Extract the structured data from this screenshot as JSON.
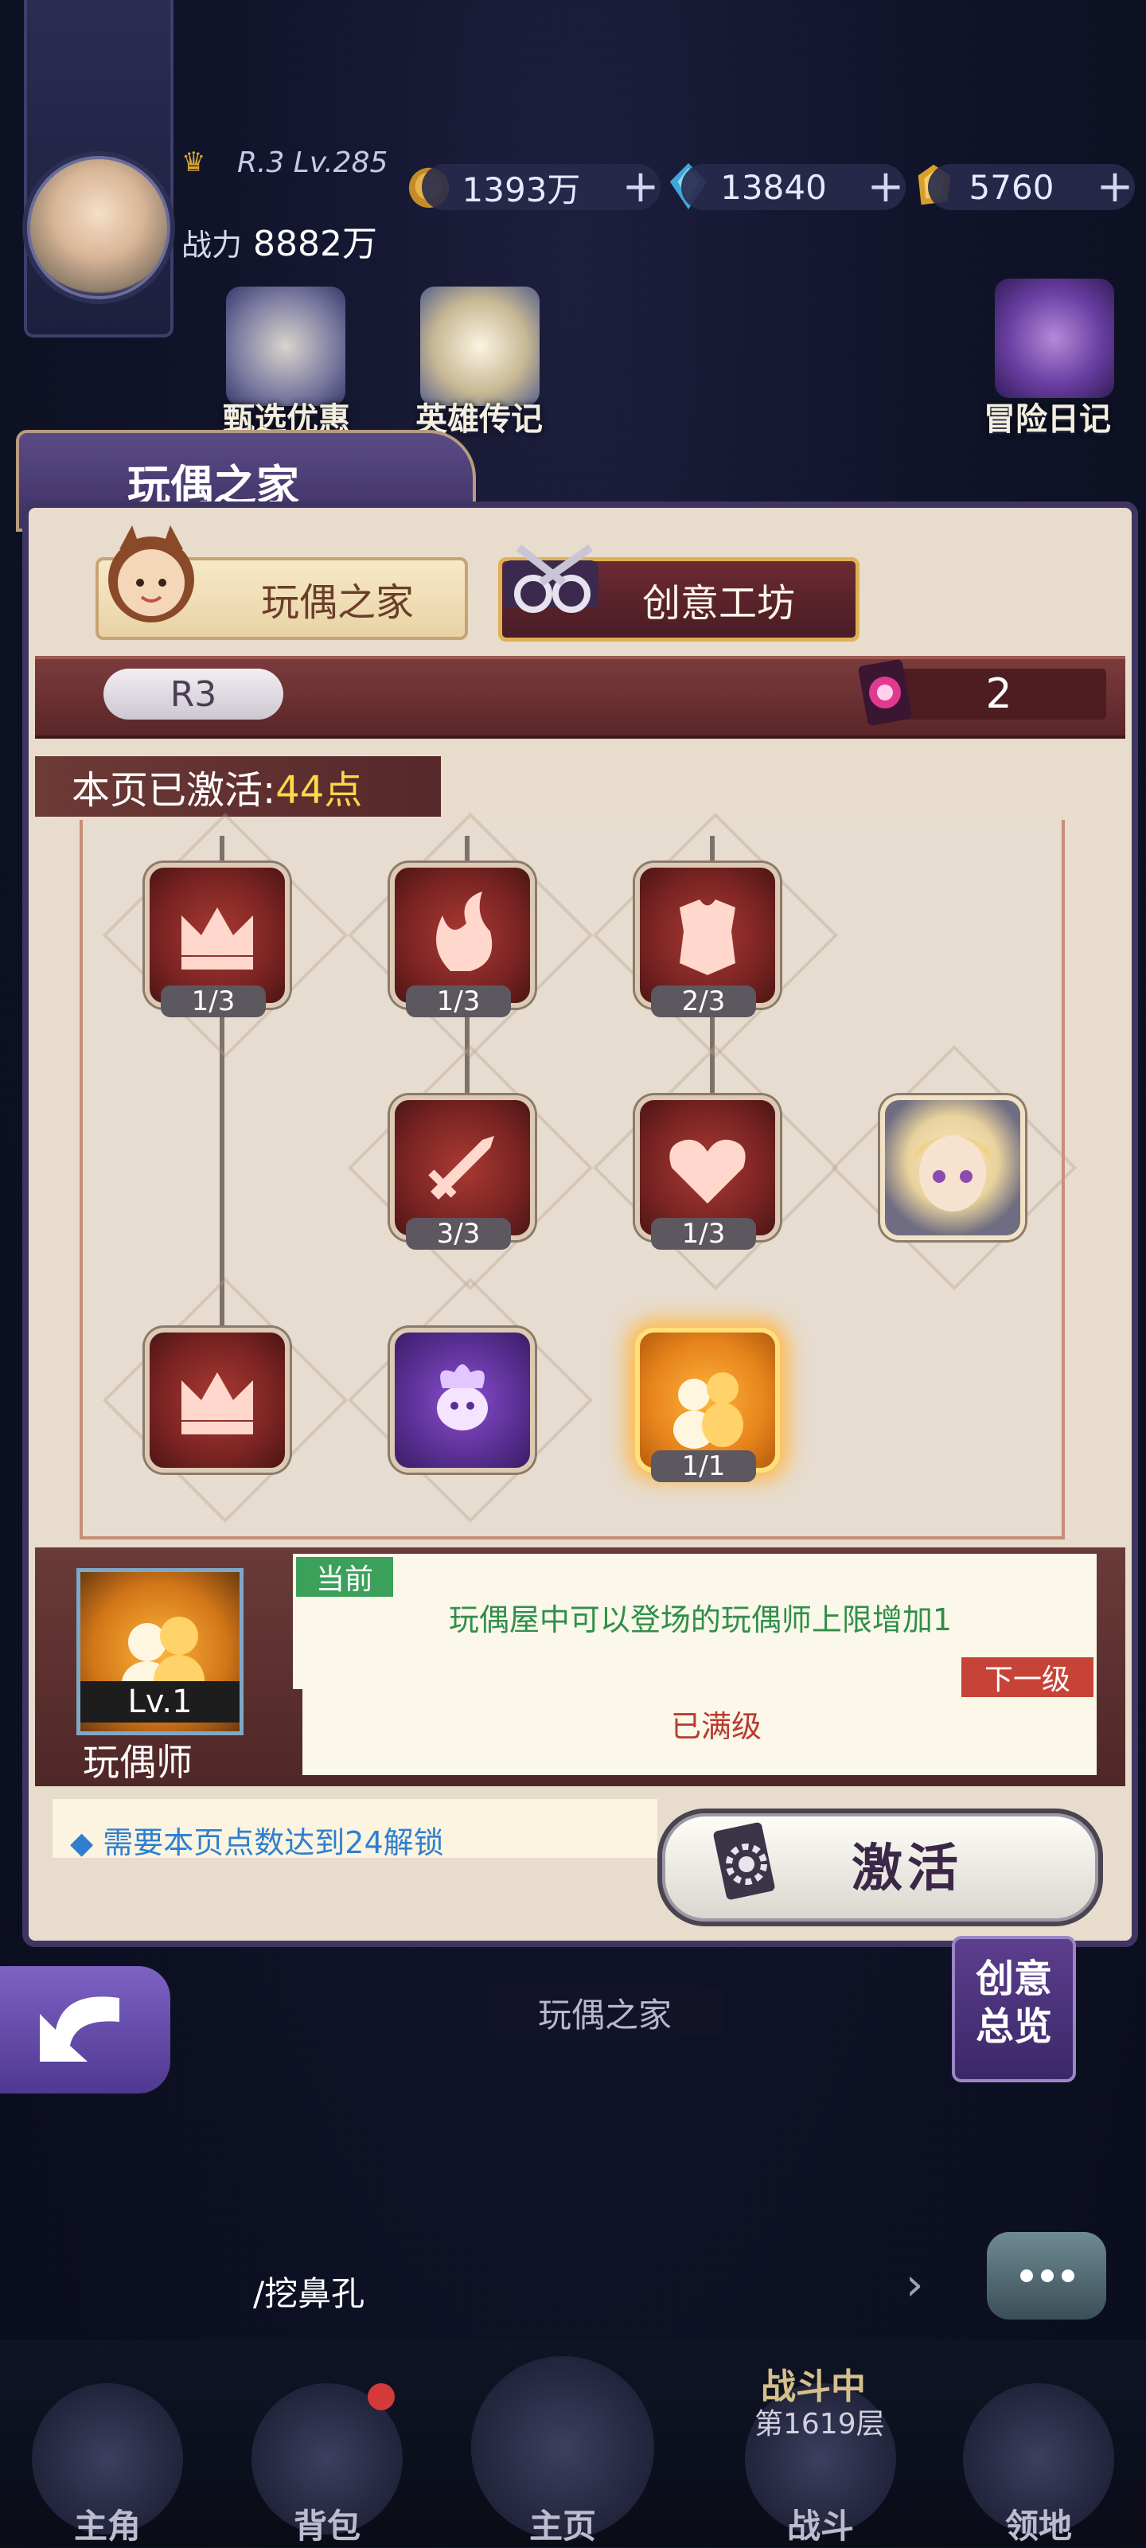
{
  "player": {
    "rank_level": "R.3 Lv.285",
    "power_label": "战力",
    "power_value": "8882万"
  },
  "resources": [
    {
      "icon": "gold-coin-icon",
      "value": "1393万"
    },
    {
      "icon": "blue-crystal-icon",
      "value": "13840"
    },
    {
      "icon": "gold-gem-icon",
      "value": "5760"
    }
  ],
  "top_icons": [
    {
      "label": "甄选优惠"
    },
    {
      "label": "英雄传记"
    },
    {
      "label": "冒险日记"
    }
  ],
  "panel": {
    "title": "玩偶之家",
    "tabs": [
      {
        "label": "玩偶之家",
        "active": false
      },
      {
        "label": "创意工坊",
        "active": true
      }
    ],
    "rank": "R3",
    "gem_count": "2",
    "activated_label": "本页已激活:",
    "activated_points": "44点"
  },
  "nodes": [
    {
      "icon": "crown-icon",
      "progress": "1/3"
    },
    {
      "icon": "flame-claw-icon",
      "progress": "1/3"
    },
    {
      "icon": "armor-icon",
      "progress": "2/3"
    },
    {
      "icon": "sword-icon",
      "progress": "3/3"
    },
    {
      "icon": "heart-icon",
      "progress": "1/3"
    },
    {
      "icon": "hero-portrait-icon",
      "progress": ""
    },
    {
      "icon": "crown-icon",
      "progress": ""
    },
    {
      "icon": "purple-spirit-icon",
      "progress": ""
    },
    {
      "icon": "doll-pair-icon",
      "progress": "1/1"
    }
  ],
  "detail": {
    "level": "Lv.1",
    "name": "玩偶师",
    "current_tag": "当前",
    "current_text": "玩偶屋中可以登场的玩偶师上限增加1",
    "next_tag": "下一级",
    "next_text": "已满级",
    "unlock_text": "◆ 需要本页点数达到24解锁",
    "activate_label": "激活"
  },
  "behind": {
    "home_label": "玩偶之家",
    "overview_label": "创意\n总览"
  },
  "chat": {
    "text": "/挖鼻孔"
  },
  "battle": {
    "status": "战斗中",
    "floor": "第1619层"
  },
  "nav": [
    {
      "label": "主角"
    },
    {
      "label": "背包"
    },
    {
      "label": "主页"
    },
    {
      "label": "战斗"
    },
    {
      "label": "领地"
    }
  ]
}
